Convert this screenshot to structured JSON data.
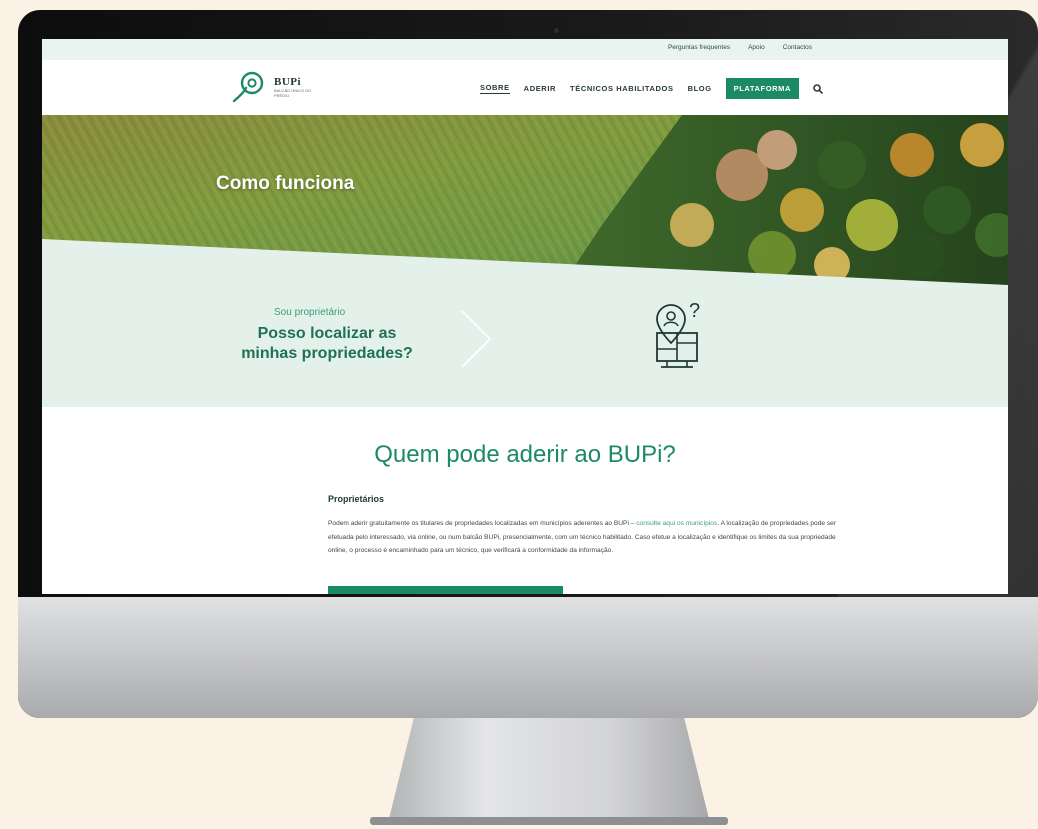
{
  "topbar": {
    "links": [
      "Perguntas frequentes",
      "Apoio",
      "Contactos"
    ]
  },
  "header": {
    "logo_name": "BUPi",
    "logo_sub": "BALCÃO ÚNICO DO PRÉDIO",
    "nav": [
      "SOBRE",
      "ADERIR",
      "TÉCNICOS HABILITADOS",
      "BLOG"
    ],
    "platform_label": "PLATAFORMA"
  },
  "hero": {
    "title": "Como funciona"
  },
  "question": {
    "kicker": "Sou proprietário",
    "title": "Posso localizar as minhas propriedades?"
  },
  "section": {
    "title": "Quem pode aderir ao BUPi?",
    "subheading": "Proprietários",
    "para_start": "Podem aderir gratuitamente os titulares de propriedades localizadas em municípios aderentes ao BUPi – ",
    "para_link": "consulte aqui os municípios",
    "para_end": ". A localização de propriedades pode ser efetuada pelo interessado, via online, ou num balcão BUPi, presencialmente, com um técnico habilitado. Caso efetue a localização e identifique os limites da sua propriedade online, o processo é encaminhado para um técnico, que verificará a conformidade da informação."
  },
  "colors": {
    "brand_green": "#1d8a66",
    "mint_band": "#e4f1eb",
    "topbar_bg": "#eaf4ef"
  },
  "icons": {
    "logo": "location-pin-logo",
    "search": "search-icon",
    "chevron": "chevron-right-icon",
    "illustration": "owner-location-question-illustration"
  }
}
